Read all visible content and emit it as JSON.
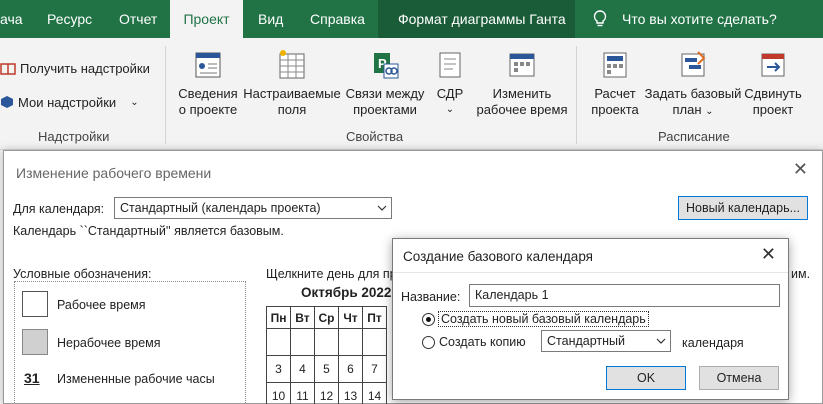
{
  "ribbon": {
    "tabs": [
      {
        "label": "ача",
        "active": false
      },
      {
        "label": "Ресурс",
        "active": false
      },
      {
        "label": "Отчет",
        "active": false
      },
      {
        "label": "Проект",
        "active": true
      },
      {
        "label": "Вид",
        "active": false
      },
      {
        "label": "Справка",
        "active": false
      }
    ],
    "format_tab": "Формат диаграммы Ганта",
    "tell_me": "Что вы хотите сделать?",
    "groups": {
      "addins": {
        "label": "Надстройки",
        "get_addins": "Получить надстройки",
        "my_addins": "Мои надстройки"
      },
      "properties": {
        "label": "Свойства",
        "project_info": [
          "Сведения",
          "о проекте"
        ],
        "custom_fields": [
          "Настраиваемые",
          "поля"
        ],
        "links": [
          "Связи между",
          "проектами"
        ],
        "wbs": "СДР",
        "change_work_time": [
          "Изменить",
          "рабочее время"
        ]
      },
      "schedule": {
        "label": "Расписание",
        "calculate": [
          "Расчет",
          "проекта"
        ],
        "set_baseline": [
          "Задать базовый",
          "план"
        ],
        "move_project": [
          "Сдвинуть",
          "проект"
        ]
      }
    }
  },
  "change_work_time_dialog": {
    "title": "Изменение рабочего времени",
    "for_calendar_label": "Для календаря:",
    "calendar_value": "Стандартный (календарь проекта)",
    "new_calendar_button": "Новый календарь...",
    "base_note": "Календарь ``Стандартный'' является базовым.",
    "legend_title": "Условные обозначения:",
    "legend": {
      "working": "Рабочее время",
      "nonworking": "Нерабочее время",
      "changed_icon": "31",
      "changed": "Измененные рабочие часы"
    },
    "click_day_text": "Щелкните день для пр",
    "right_fragment": "им.",
    "month_title": "Октябрь 2022",
    "weekdays": [
      "Пн",
      "Вт",
      "Ср",
      "Чт",
      "Пт"
    ],
    "rows": [
      [
        "",
        "",
        "",
        "",
        ""
      ],
      [
        "3",
        "4",
        "5",
        "6",
        "7"
      ],
      [
        "10",
        "11",
        "12",
        "13",
        "14"
      ]
    ]
  },
  "create_calendar_dialog": {
    "title": "Создание базового календаря",
    "name_label": "Название:",
    "name_value": "Календарь 1",
    "option_new": "Создать новый базовый календарь",
    "option_copy": "Создать копию",
    "copy_source": "Стандартный",
    "copy_suffix": "календаря",
    "ok": "OK",
    "cancel": "Отмена",
    "selected_option": "new"
  },
  "colors": {
    "ribbon_green": "#217346",
    "format_tab_bg": "#1a5c37",
    "focus_blue": "#0078d7"
  }
}
